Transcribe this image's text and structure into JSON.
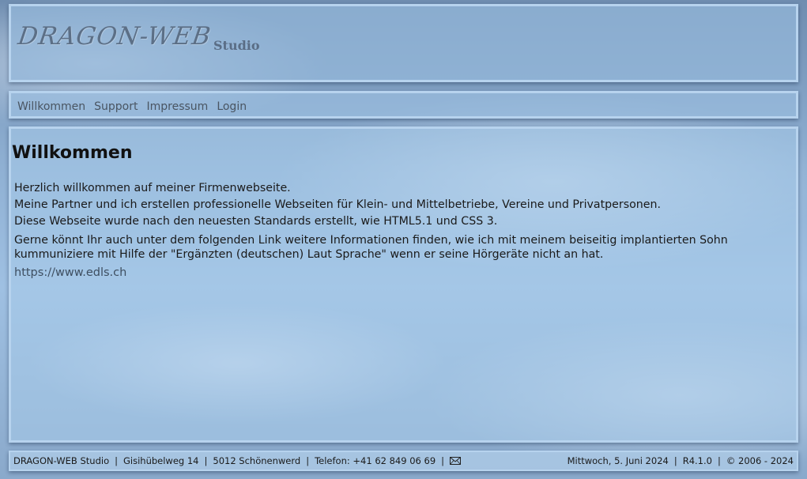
{
  "header": {
    "logo_text": "DRAGON-WEB",
    "logo_sub": "Studio"
  },
  "nav": {
    "items": [
      {
        "label": "Willkommen"
      },
      {
        "label": "Support"
      },
      {
        "label": "Impressum"
      },
      {
        "label": "Login"
      }
    ]
  },
  "main": {
    "title": "Willkommen",
    "paragraphs": [
      "Herzlich willkommen auf meiner Firmenwebseite.",
      "Meine Partner und ich erstellen professionelle Webseiten für Klein- und Mittelbetriebe, Vereine und Privatpersonen.",
      "Diese Webseite wurde nach den neuesten Standards erstellt, wie HTML5.1 und CSS 3.",
      "Gerne könnt Ihr auch unter dem folgenden Link weitere Informationen finden, wie ich mit meinem beiseitig implantierten Sohn kummuniziere mit Hilfe der \"Ergänzten (deutschen) Laut Sprache\" wenn er seine Hörgeräte nicht an hat."
    ],
    "link_text": "https://www.edls.ch"
  },
  "footer": {
    "company": "DRAGON-WEB Studio",
    "street": "Gisihübelweg 14",
    "city": "5012 Schönenwerd",
    "phone": "Telefon: +41 62 849 06 69",
    "mail_icon": "envelope-icon",
    "date": "Mittwoch, 5. Juni 2024",
    "version": "R4.1.0",
    "copyright": "© 2006 - 2024",
    "separator": "|"
  }
}
